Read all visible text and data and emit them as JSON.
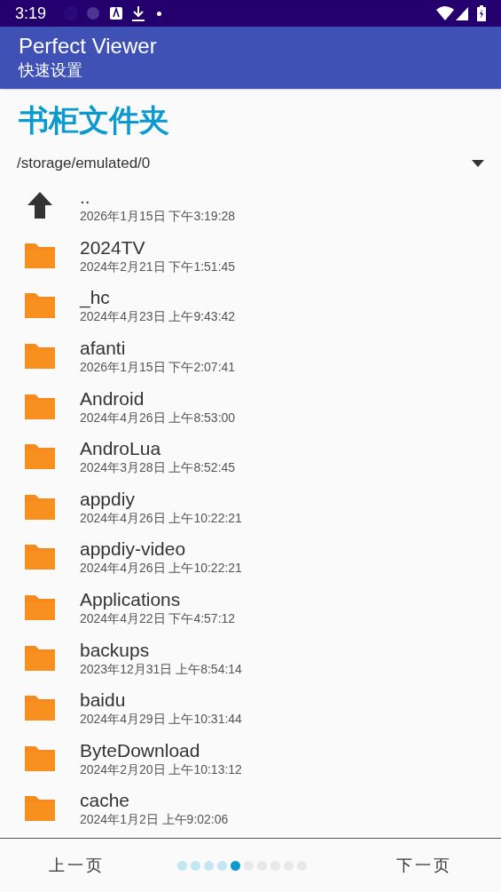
{
  "status_bar": {
    "time": "3:19"
  },
  "app_bar": {
    "title": "Perfect Viewer",
    "subtitle": "快速设置"
  },
  "heading": "书柜文件夹",
  "path": "/storage/emulated/0",
  "entries": [
    {
      "kind": "parent",
      "name": "..",
      "date": "2026年1月15日 下午3:19:28"
    },
    {
      "kind": "folder",
      "name": "2024TV",
      "date": "2024年2月21日 下午1:51:45"
    },
    {
      "kind": "folder",
      "name": "_hc",
      "date": "2024年4月23日 上午9:43:42"
    },
    {
      "kind": "folder",
      "name": "afanti",
      "date": "2026年1月15日 下午2:07:41"
    },
    {
      "kind": "folder",
      "name": "Android",
      "date": "2024年4月26日 上午8:53:00"
    },
    {
      "kind": "folder",
      "name": "AndroLua",
      "date": "2024年3月28日 上午8:52:45"
    },
    {
      "kind": "folder",
      "name": "appdiy",
      "date": "2024年4月26日 上午10:22:21"
    },
    {
      "kind": "folder",
      "name": "appdiy-video",
      "date": "2024年4月26日 上午10:22:21"
    },
    {
      "kind": "folder",
      "name": "Applications",
      "date": "2024年4月22日 下午4:57:12"
    },
    {
      "kind": "folder",
      "name": "backups",
      "date": "2023年12月31日 上午8:54:14"
    },
    {
      "kind": "folder",
      "name": "baidu",
      "date": "2024年4月29日 上午10:31:44"
    },
    {
      "kind": "folder",
      "name": "ByteDownload",
      "date": "2024年2月20日 上午10:13:12"
    },
    {
      "kind": "folder",
      "name": "cache",
      "date": "2024年1月2日 上午9:02:06"
    }
  ],
  "pager": {
    "previous": "上一页",
    "next": "下一页",
    "dots": [
      {
        "visited": true,
        "selected": false
      },
      {
        "visited": true,
        "selected": false
      },
      {
        "visited": true,
        "selected": false
      },
      {
        "visited": true,
        "selected": false
      },
      {
        "selected": true
      },
      {
        "visited": false,
        "selected": false
      },
      {
        "visited": false,
        "selected": false
      },
      {
        "visited": false,
        "selected": false
      },
      {
        "visited": false,
        "selected": false
      },
      {
        "visited": false,
        "selected": false
      }
    ]
  }
}
